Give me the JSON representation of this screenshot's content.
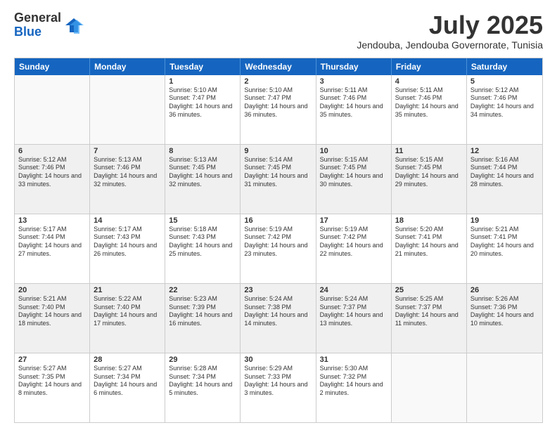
{
  "logo": {
    "general": "General",
    "blue": "Blue"
  },
  "title": "July 2025",
  "subtitle": "Jendouba, Jendouba Governorate, Tunisia",
  "header_days": [
    "Sunday",
    "Monday",
    "Tuesday",
    "Wednesday",
    "Thursday",
    "Friday",
    "Saturday"
  ],
  "weeks": [
    [
      {
        "day": "",
        "sunrise": "",
        "sunset": "",
        "daylight": "",
        "empty": true
      },
      {
        "day": "",
        "sunrise": "",
        "sunset": "",
        "daylight": "",
        "empty": true
      },
      {
        "day": "1",
        "sunrise": "Sunrise: 5:10 AM",
        "sunset": "Sunset: 7:47 PM",
        "daylight": "Daylight: 14 hours and 36 minutes.",
        "empty": false
      },
      {
        "day": "2",
        "sunrise": "Sunrise: 5:10 AM",
        "sunset": "Sunset: 7:47 PM",
        "daylight": "Daylight: 14 hours and 36 minutes.",
        "empty": false
      },
      {
        "day": "3",
        "sunrise": "Sunrise: 5:11 AM",
        "sunset": "Sunset: 7:46 PM",
        "daylight": "Daylight: 14 hours and 35 minutes.",
        "empty": false
      },
      {
        "day": "4",
        "sunrise": "Sunrise: 5:11 AM",
        "sunset": "Sunset: 7:46 PM",
        "daylight": "Daylight: 14 hours and 35 minutes.",
        "empty": false
      },
      {
        "day": "5",
        "sunrise": "Sunrise: 5:12 AM",
        "sunset": "Sunset: 7:46 PM",
        "daylight": "Daylight: 14 hours and 34 minutes.",
        "empty": false
      }
    ],
    [
      {
        "day": "6",
        "sunrise": "Sunrise: 5:12 AM",
        "sunset": "Sunset: 7:46 PM",
        "daylight": "Daylight: 14 hours and 33 minutes.",
        "empty": false
      },
      {
        "day": "7",
        "sunrise": "Sunrise: 5:13 AM",
        "sunset": "Sunset: 7:46 PM",
        "daylight": "Daylight: 14 hours and 32 minutes.",
        "empty": false
      },
      {
        "day": "8",
        "sunrise": "Sunrise: 5:13 AM",
        "sunset": "Sunset: 7:45 PM",
        "daylight": "Daylight: 14 hours and 32 minutes.",
        "empty": false
      },
      {
        "day": "9",
        "sunrise": "Sunrise: 5:14 AM",
        "sunset": "Sunset: 7:45 PM",
        "daylight": "Daylight: 14 hours and 31 minutes.",
        "empty": false
      },
      {
        "day": "10",
        "sunrise": "Sunrise: 5:15 AM",
        "sunset": "Sunset: 7:45 PM",
        "daylight": "Daylight: 14 hours and 30 minutes.",
        "empty": false
      },
      {
        "day": "11",
        "sunrise": "Sunrise: 5:15 AM",
        "sunset": "Sunset: 7:45 PM",
        "daylight": "Daylight: 14 hours and 29 minutes.",
        "empty": false
      },
      {
        "day": "12",
        "sunrise": "Sunrise: 5:16 AM",
        "sunset": "Sunset: 7:44 PM",
        "daylight": "Daylight: 14 hours and 28 minutes.",
        "empty": false
      }
    ],
    [
      {
        "day": "13",
        "sunrise": "Sunrise: 5:17 AM",
        "sunset": "Sunset: 7:44 PM",
        "daylight": "Daylight: 14 hours and 27 minutes.",
        "empty": false
      },
      {
        "day": "14",
        "sunrise": "Sunrise: 5:17 AM",
        "sunset": "Sunset: 7:43 PM",
        "daylight": "Daylight: 14 hours and 26 minutes.",
        "empty": false
      },
      {
        "day": "15",
        "sunrise": "Sunrise: 5:18 AM",
        "sunset": "Sunset: 7:43 PM",
        "daylight": "Daylight: 14 hours and 25 minutes.",
        "empty": false
      },
      {
        "day": "16",
        "sunrise": "Sunrise: 5:19 AM",
        "sunset": "Sunset: 7:42 PM",
        "daylight": "Daylight: 14 hours and 23 minutes.",
        "empty": false
      },
      {
        "day": "17",
        "sunrise": "Sunrise: 5:19 AM",
        "sunset": "Sunset: 7:42 PM",
        "daylight": "Daylight: 14 hours and 22 minutes.",
        "empty": false
      },
      {
        "day": "18",
        "sunrise": "Sunrise: 5:20 AM",
        "sunset": "Sunset: 7:41 PM",
        "daylight": "Daylight: 14 hours and 21 minutes.",
        "empty": false
      },
      {
        "day": "19",
        "sunrise": "Sunrise: 5:21 AM",
        "sunset": "Sunset: 7:41 PM",
        "daylight": "Daylight: 14 hours and 20 minutes.",
        "empty": false
      }
    ],
    [
      {
        "day": "20",
        "sunrise": "Sunrise: 5:21 AM",
        "sunset": "Sunset: 7:40 PM",
        "daylight": "Daylight: 14 hours and 18 minutes.",
        "empty": false
      },
      {
        "day": "21",
        "sunrise": "Sunrise: 5:22 AM",
        "sunset": "Sunset: 7:40 PM",
        "daylight": "Daylight: 14 hours and 17 minutes.",
        "empty": false
      },
      {
        "day": "22",
        "sunrise": "Sunrise: 5:23 AM",
        "sunset": "Sunset: 7:39 PM",
        "daylight": "Daylight: 14 hours and 16 minutes.",
        "empty": false
      },
      {
        "day": "23",
        "sunrise": "Sunrise: 5:24 AM",
        "sunset": "Sunset: 7:38 PM",
        "daylight": "Daylight: 14 hours and 14 minutes.",
        "empty": false
      },
      {
        "day": "24",
        "sunrise": "Sunrise: 5:24 AM",
        "sunset": "Sunset: 7:37 PM",
        "daylight": "Daylight: 14 hours and 13 minutes.",
        "empty": false
      },
      {
        "day": "25",
        "sunrise": "Sunrise: 5:25 AM",
        "sunset": "Sunset: 7:37 PM",
        "daylight": "Daylight: 14 hours and 11 minutes.",
        "empty": false
      },
      {
        "day": "26",
        "sunrise": "Sunrise: 5:26 AM",
        "sunset": "Sunset: 7:36 PM",
        "daylight": "Daylight: 14 hours and 10 minutes.",
        "empty": false
      }
    ],
    [
      {
        "day": "27",
        "sunrise": "Sunrise: 5:27 AM",
        "sunset": "Sunset: 7:35 PM",
        "daylight": "Daylight: 14 hours and 8 minutes.",
        "empty": false
      },
      {
        "day": "28",
        "sunrise": "Sunrise: 5:27 AM",
        "sunset": "Sunset: 7:34 PM",
        "daylight": "Daylight: 14 hours and 6 minutes.",
        "empty": false
      },
      {
        "day": "29",
        "sunrise": "Sunrise: 5:28 AM",
        "sunset": "Sunset: 7:34 PM",
        "daylight": "Daylight: 14 hours and 5 minutes.",
        "empty": false
      },
      {
        "day": "30",
        "sunrise": "Sunrise: 5:29 AM",
        "sunset": "Sunset: 7:33 PM",
        "daylight": "Daylight: 14 hours and 3 minutes.",
        "empty": false
      },
      {
        "day": "31",
        "sunrise": "Sunrise: 5:30 AM",
        "sunset": "Sunset: 7:32 PM",
        "daylight": "Daylight: 14 hours and 2 minutes.",
        "empty": false
      },
      {
        "day": "",
        "sunrise": "",
        "sunset": "",
        "daylight": "",
        "empty": true
      },
      {
        "day": "",
        "sunrise": "",
        "sunset": "",
        "daylight": "",
        "empty": true
      }
    ]
  ]
}
